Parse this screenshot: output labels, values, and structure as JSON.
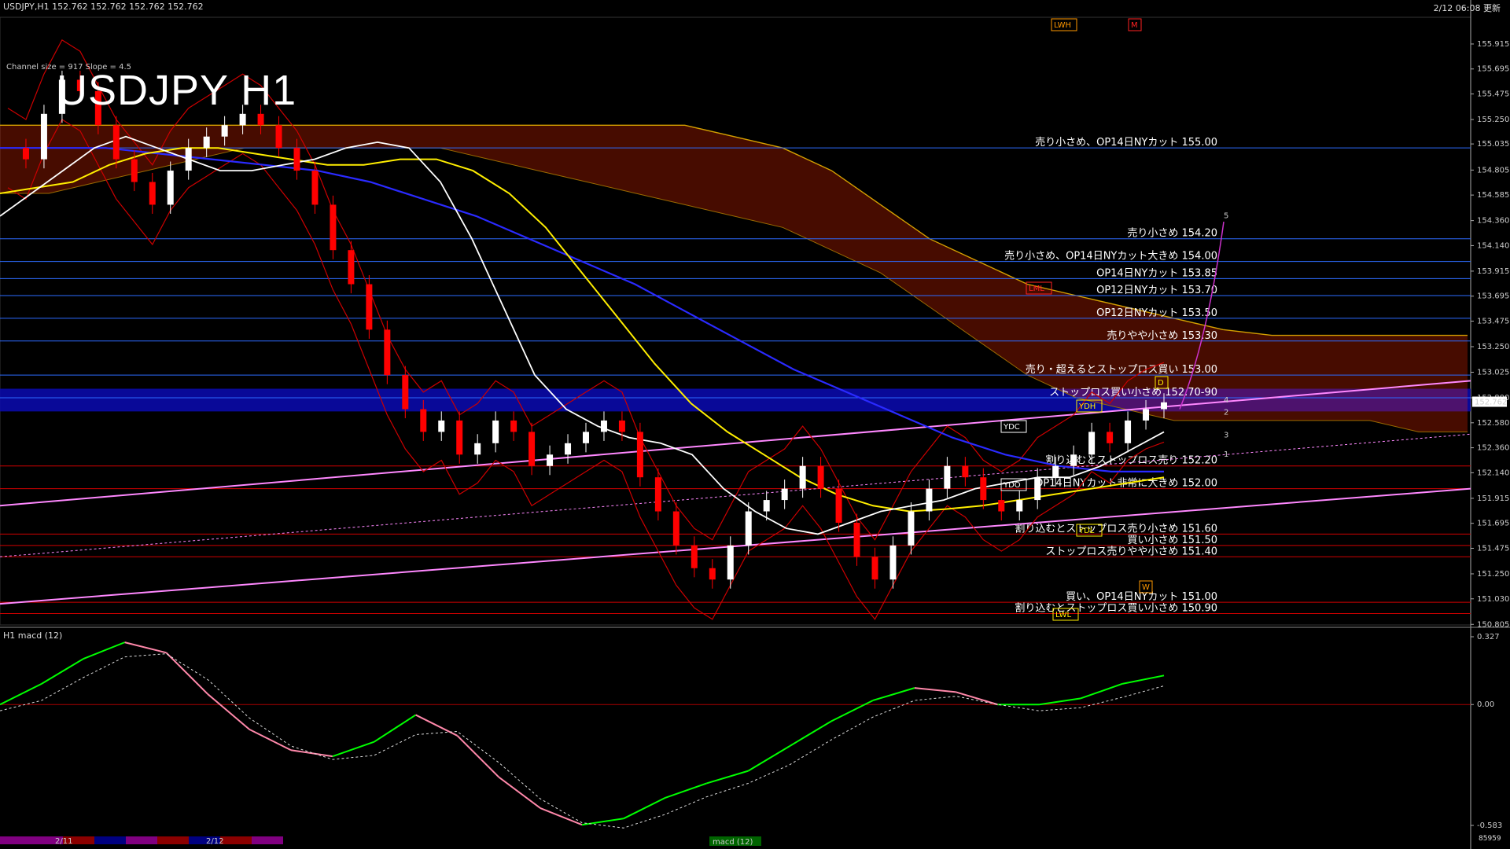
{
  "header": {
    "symbol_info": "USDJPY,H1  152.762 152.762 152.762 152.762",
    "datetime": "2/12 06:08 更新",
    "title": "USDJPY H1",
    "channel_info": "Channel size = 917 Slope = 4.5"
  },
  "sub_header": {
    "indicator": "H1  macd (12)",
    "status_right": "85959"
  },
  "colors": {
    "up_candle": "#ffffff",
    "down_candle": "#ff0000",
    "level_line": "#2d6bff",
    "kumo": "#ff2a00",
    "ma_white": "#ffffff",
    "ma_yellow": "#ffee00",
    "ma_blue": "#2a2aff",
    "macd_up": "#00ff00",
    "macd_down": "#ff88aa",
    "band_red": "#cc0000",
    "rsi_green": "#00c000"
  },
  "chart_data": {
    "type": "line",
    "ylim": [
      150.8,
      156.15
    ],
    "y_ticks": [
      "155.915",
      "155.695",
      "155.475",
      "155.250",
      "155.035",
      "154.805",
      "154.585",
      "154.360",
      "154.140",
      "153.915",
      "153.695",
      "153.475",
      "153.250",
      "153.025",
      "152.800",
      "152.580",
      "152.360",
      "152.140",
      "151.915",
      "151.695",
      "151.475",
      "151.250",
      "151.030",
      "150.805"
    ],
    "current_price": "152.762",
    "levels": [
      {
        "price": 155.0,
        "label": "売り小さめ、OP14日NYカット 155.00"
      },
      {
        "price": 154.2,
        "label": "売り小さめ 154.20"
      },
      {
        "price": 154.0,
        "label": "売り小さめ、OP14日NYカット大きめ 154.00"
      },
      {
        "price": 153.85,
        "label": "OP14日NYカット 153.85"
      },
      {
        "price": 153.7,
        "label": "OP12日NYカット 153.70"
      },
      {
        "price": 153.5,
        "label": "OP12日NYカット 153.50"
      },
      {
        "price": 153.3,
        "label": "売りやや小さめ 153.30"
      },
      {
        "price": 153.0,
        "label": "売り・超えるとストップロス買い 153.00"
      },
      {
        "price": 152.8,
        "label": "ストップロス買い小さめ 152.70-90"
      },
      {
        "price": 152.2,
        "label": "割り込むとストップロス売り 152.20"
      },
      {
        "price": 152.0,
        "label": "OP14日NYカット非常に大きめ 152.00"
      },
      {
        "price": 151.6,
        "label": "割り込むとストップロス売り小さめ 151.60"
      },
      {
        "price": 151.5,
        "label": "買い小さめ 151.50"
      },
      {
        "price": 151.4,
        "label": "ストップロス売りやや小さめ 151.40"
      },
      {
        "price": 151.0,
        "label": "買い、OP14日NYカット 151.00"
      },
      {
        "price": 150.9,
        "label": "割り込むとストップロス買い小さめ 150.90"
      }
    ],
    "blue_band": [
      152.68,
      152.88
    ],
    "close_path": [
      155.0,
      154.9,
      155.3,
      155.6,
      155.5,
      155.2,
      154.9,
      154.7,
      154.5,
      154.8,
      155.0,
      155.1,
      155.2,
      155.3,
      155.2,
      155.0,
      154.8,
      154.5,
      154.1,
      153.8,
      153.4,
      153.0,
      152.7,
      152.5,
      152.6,
      152.3,
      152.4,
      152.6,
      152.5,
      152.2,
      152.3,
      152.4,
      152.5,
      152.6,
      152.5,
      152.1,
      151.8,
      151.5,
      151.3,
      151.2,
      151.5,
      151.8,
      151.9,
      152.0,
      152.2,
      152.0,
      151.7,
      151.4,
      151.2,
      151.5,
      151.8,
      152.0,
      152.2,
      152.1,
      151.9,
      151.8,
      151.9,
      152.1,
      152.2,
      152.3,
      152.5,
      152.4,
      152.6,
      152.7,
      152.76
    ],
    "kumo_upper": [
      155.2,
      155.2,
      155.2,
      155.2,
      155.2,
      155.2,
      155.2,
      155.2,
      155.2,
      155.2,
      155.2,
      155.2,
      155.2,
      155.2,
      155.2,
      155.1,
      155.0,
      154.8,
      154.5,
      154.2,
      154.0,
      153.8,
      153.7,
      153.6,
      153.5,
      153.4,
      153.35,
      153.35,
      153.35,
      153.35,
      153.35
    ],
    "kumo_lower": [
      154.6,
      154.6,
      154.7,
      154.8,
      154.9,
      155.0,
      155.0,
      155.0,
      155.0,
      155.0,
      154.9,
      154.8,
      154.7,
      154.6,
      154.5,
      154.4,
      154.3,
      154.1,
      153.9,
      153.6,
      153.3,
      153.0,
      152.8,
      152.7,
      152.6,
      152.6,
      152.6,
      152.6,
      152.6,
      152.5,
      152.5
    ],
    "ma_white": [
      154.4,
      154.6,
      154.8,
      155.0,
      155.1,
      155.0,
      154.9,
      154.8,
      154.8,
      154.85,
      154.9,
      155.0,
      155.05,
      155.0,
      154.7,
      154.2,
      153.6,
      153.0,
      152.7,
      152.55,
      152.45,
      152.4,
      152.3,
      152.0,
      151.8,
      151.65,
      151.6,
      151.7,
      151.8,
      151.85,
      151.9,
      152.0,
      152.05,
      152.1,
      152.1,
      152.2,
      152.35,
      152.5
    ],
    "ma_yellow": [
      154.6,
      154.65,
      154.7,
      154.85,
      154.95,
      155.0,
      155.0,
      154.95,
      154.9,
      154.85,
      154.85,
      154.9,
      154.9,
      154.8,
      154.6,
      154.3,
      153.9,
      153.5,
      153.1,
      152.75,
      152.5,
      152.3,
      152.1,
      151.95,
      151.85,
      151.8,
      151.82,
      151.85,
      151.9,
      151.95,
      152.0,
      152.05,
      152.1
    ],
    "ma_blue": [
      155.0,
      155.0,
      155.0,
      154.95,
      154.9,
      154.85,
      154.8,
      154.7,
      154.55,
      154.4,
      154.2,
      154.0,
      153.8,
      153.55,
      153.3,
      153.05,
      152.85,
      152.65,
      152.45,
      152.3,
      152.2,
      152.15,
      152.15
    ],
    "macd": [
      0.0,
      0.1,
      0.22,
      0.3,
      0.25,
      0.05,
      -0.12,
      -0.22,
      -0.25,
      -0.18,
      -0.05,
      -0.15,
      -0.35,
      -0.5,
      -0.58,
      -0.55,
      -0.45,
      -0.38,
      -0.32,
      -0.2,
      -0.08,
      0.02,
      0.08,
      0.06,
      0.0,
      0.0,
      0.03,
      0.1,
      0.14
    ],
    "macd_ylim": [
      -0.583,
      0.327
    ],
    "macd_ticks": [
      "0.327",
      "0.00",
      "-0.583"
    ],
    "x_labels": [
      "2/11",
      "2/12"
    ]
  },
  "tags": [
    "LWH",
    "M",
    "LML",
    "YDH",
    "YDC",
    "YDO",
    "YDL",
    "LWL",
    "W",
    "D"
  ],
  "wave_labels": [
    "5",
    "4",
    "3",
    "2",
    "1"
  ],
  "footer_tab": "macd (12)"
}
